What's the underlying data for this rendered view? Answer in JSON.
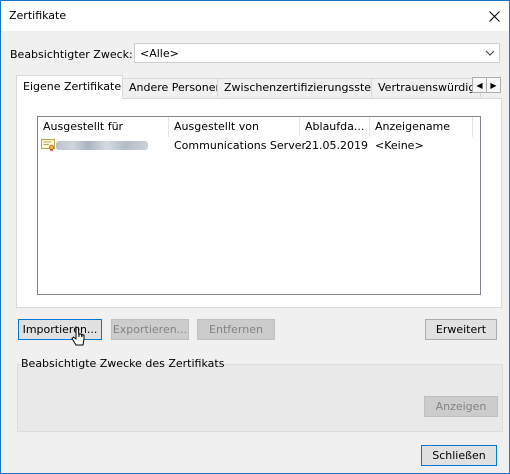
{
  "window": {
    "title": "Zertifikate"
  },
  "purpose": {
    "label": "Beabsichtigter Zweck:",
    "value": "<Alle>"
  },
  "tabs": [
    {
      "label": "Eigene Zertifikate",
      "active": true
    },
    {
      "label": "Andere Personen",
      "active": false
    },
    {
      "label": "Zwischenzertifizierungsstellen",
      "active": false
    },
    {
      "label": "Vertrauenswürdige S",
      "active": false
    }
  ],
  "table": {
    "columns": [
      "Ausgestellt für",
      "Ausgestellt von",
      "Ablaufda...",
      "Anzeigename"
    ],
    "rows": [
      {
        "issued_to": "",
        "issued_by": "Communications Server",
        "expiry": "21.05.2019",
        "display_name": "<Keine>"
      }
    ]
  },
  "buttons": {
    "import": "Importieren...",
    "export": "Exportieren...",
    "remove": "Entfernen",
    "advanced": "Erweitert",
    "view": "Anzeigen",
    "close": "Schließen"
  },
  "purposes_group": {
    "label": "Beabsichtigte Zwecke des Zertifikats"
  },
  "icons": {
    "close": "close-icon",
    "dropdown": "chevron-down-icon",
    "certificate": "certificate-icon"
  },
  "colors": {
    "window_border": "#1c73c9",
    "focus_border": "#0078d7"
  }
}
